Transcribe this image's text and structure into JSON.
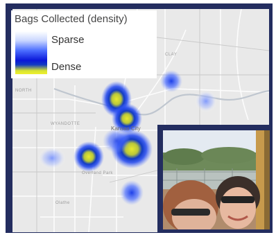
{
  "legend": {
    "title": "Bags Collected (density)",
    "sparse_label": "Sparse",
    "dense_label": "Dense"
  },
  "map": {
    "city_label": "Kansas City",
    "place_labels": [
      "CLAY",
      "NORTH",
      "WYANDOTTE",
      "Overland Park",
      "Olathe"
    ]
  },
  "heat_points": [
    {
      "name": "north-cluster",
      "density": 0.85
    },
    {
      "name": "downtown",
      "density": 0.75
    },
    {
      "name": "west",
      "density": 0.9
    },
    {
      "name": "central-south",
      "density": 0.9
    },
    {
      "name": "clay-north",
      "density": 0.35
    },
    {
      "name": "east",
      "density": 0.25
    },
    {
      "name": "south",
      "density": 0.35
    },
    {
      "name": "far-west",
      "density": 0.15
    }
  ],
  "colors": {
    "frame": "#232d5f",
    "heat_sparse": "#4b6dff",
    "heat_dense": "#e0e62e"
  }
}
